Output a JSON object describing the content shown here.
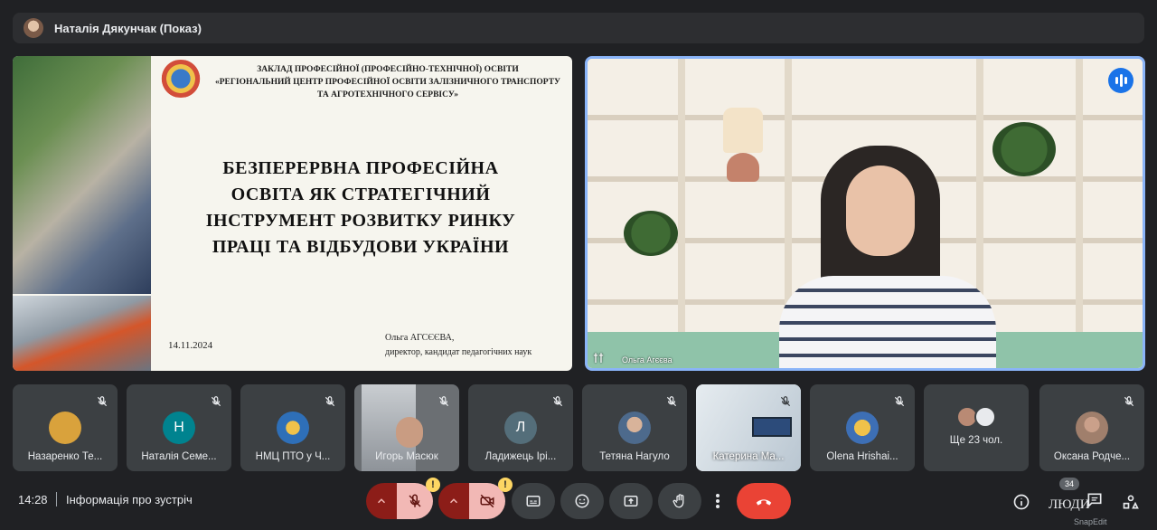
{
  "presenter": {
    "name": "Наталія Дякунчак (Показ)"
  },
  "slide": {
    "header_line1": "ЗАКЛАД ПРОФЕСІЙНОЇ (ПРОФЕСІЙНО-ТЕХНІЧНОЇ) ОСВІТИ",
    "header_line2": "«РЕГІОНАЛЬНИЙ ЦЕНТР ПРОФЕСІЙНОЇ ОСВІТИ ЗАЛІЗНИЧНОГО ТРАНСПОРТУ",
    "header_line3": "ТА АГРОТЕХНІЧНОГО СЕРВІСУ»",
    "title_line1": "БЕЗПЕРЕРВНА ПРОФЕСІЙНА",
    "title_line2": "ОСВІТА ЯК СТРАТЕГІЧНИЙ",
    "title_line3": "ІНСТРУМЕНТ РОЗВИТКУ РИНКУ",
    "title_line4": "ПРАЦІ ТА ВІДБУДОВИ УКРАЇНИ",
    "date": "14.11.2024",
    "author_line1": "Ольга АГСЄЄВА,",
    "author_line2": "директор, кандидат педагогічних наук"
  },
  "speaker": {
    "name": "Ольга Агєєва",
    "logo": "ꝉꝉ"
  },
  "participants": [
    {
      "name": "Назаренко Те...",
      "avatar_type": "photo",
      "avatar_color": "#d9a23c"
    },
    {
      "name": "Наталія Семе...",
      "avatar_type": "letter",
      "letter": "Н",
      "avatar_color": "#00838f"
    },
    {
      "name": "НМЦ ПТО у Ч...",
      "avatar_type": "photo",
      "avatar_color": "#2e6fb8"
    },
    {
      "name": "Игорь Масюк",
      "avatar_type": "video",
      "avatar_color": "#5b6066"
    },
    {
      "name": "Ладижець Ірі...",
      "avatar_type": "letter",
      "letter": "Л",
      "avatar_color": "#546e7a"
    },
    {
      "name": "Тетяна Нагуло",
      "avatar_type": "photo",
      "avatar_color": "#4d6a8c"
    },
    {
      "name": "Катерина Ма...",
      "avatar_type": "video",
      "avatar_color": "#cfd8dc"
    },
    {
      "name": "Olena Hrishai...",
      "avatar_type": "photo",
      "avatar_color": "#3d6fb5"
    },
    {
      "name": "Ще 23 чол.",
      "avatar_type": "more"
    },
    {
      "name": "Оксана Родче...",
      "avatar_type": "photo",
      "avatar_color": "#a07f6c"
    }
  ],
  "bottom_bar": {
    "time": "14:28",
    "meeting_info": "Інформація про зустріч",
    "people_count": "34",
    "people_label": "ЛЮДИ",
    "warning_glyph": "!",
    "watermark": "SnapEdit"
  },
  "icons": {
    "mute": "mic-off-icon",
    "camera": "camera-off-icon",
    "captions": "captions-icon",
    "emoji": "emoji-icon",
    "present": "present-screen-icon",
    "hand": "raise-hand-icon",
    "more": "more-options-icon",
    "end": "end-call-icon",
    "info": "info-icon",
    "chat": "chat-icon",
    "activities": "activities-icon"
  },
  "colors": {
    "accent": "#8ab4f8",
    "end_call": "#ea4335",
    "warning": "#fdd663",
    "mic_off_bg": "#f2b8b5"
  }
}
